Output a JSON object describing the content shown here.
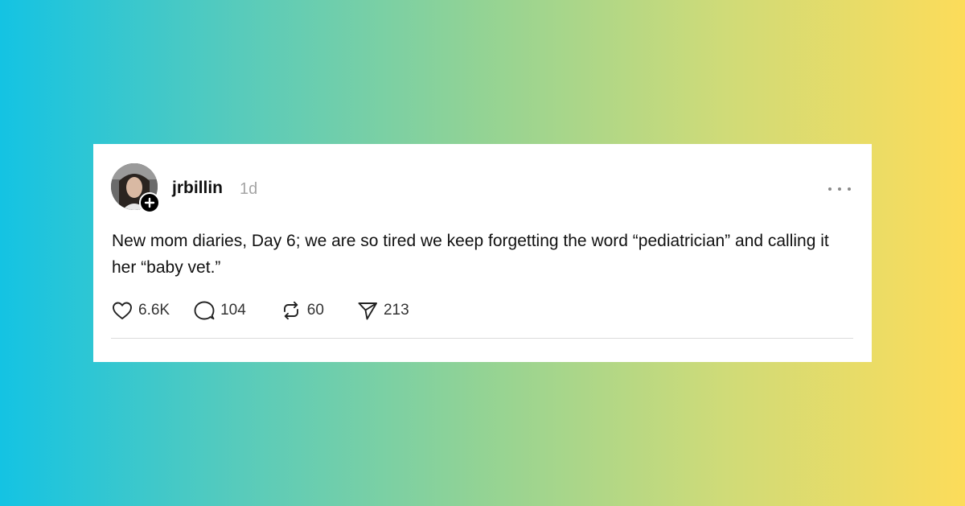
{
  "post": {
    "username": "jrbillin",
    "timestamp": "1d",
    "text": "New mom diaries, Day 6; we are so tired we keep forgetting the word “pediatrician” and calling it her “baby vet.”",
    "likes": "6.6K",
    "replies": "104",
    "reposts": "60",
    "shares": "213"
  },
  "icons": {
    "like": "heart-icon",
    "reply": "speech-bubble-icon",
    "repost": "repost-icon",
    "share": "send-icon",
    "more": "ellipsis-icon",
    "follow": "plus-icon"
  },
  "colors": {
    "gradient_left": "#14c3e3",
    "gradient_right": "#fcdc5a",
    "timestamp": "#a6a6a6"
  }
}
